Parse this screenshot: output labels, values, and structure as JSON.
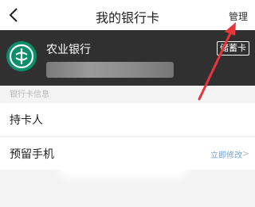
{
  "header": {
    "back_glyph": "<",
    "title": "我的银行卡",
    "manage_label": "管理"
  },
  "card": {
    "bank_name": "农业银行",
    "badge_label": "储蓄卡",
    "logo_icon": "abc-bank-logo",
    "logo_color": "#0b8e6a"
  },
  "section": {
    "title": "银行卡信息"
  },
  "rows": [
    {
      "label": "持卡人"
    },
    {
      "label": "预留手机",
      "action_label": "立即修改",
      "chevron": ">"
    }
  ],
  "annotation": {
    "color": "#e8343b"
  }
}
